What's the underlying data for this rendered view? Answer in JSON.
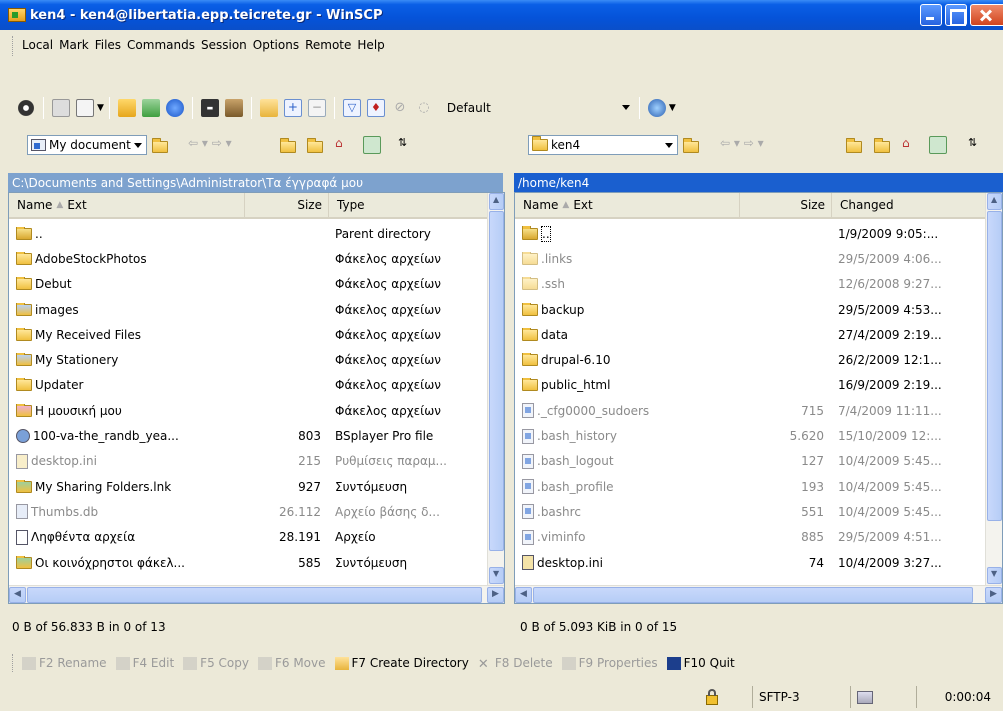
{
  "window": {
    "title": "ken4 - ken4@libertatia.epp.teicrete.gr - WinSCP"
  },
  "menu": [
    "Local",
    "Mark",
    "Files",
    "Commands",
    "Session",
    "Options",
    "Remote",
    "Help"
  ],
  "toolbar": {
    "transfer_settings": "Default"
  },
  "left": {
    "location": "My document",
    "path": "C:\\Documents and Settings\\Administrator\\Τα έγγραφά μου",
    "columns": [
      "Name",
      "Ext",
      "Size",
      "Type"
    ],
    "rows": [
      {
        "name": "..",
        "size": "",
        "type": "Parent directory",
        "icon": "parent-dir-icon"
      },
      {
        "name": "AdobeStockPhotos",
        "size": "",
        "type": "Φάκελος αρχείων",
        "icon": "folder-icon"
      },
      {
        "name": "Debut",
        "size": "",
        "type": "Φάκελος αρχείων",
        "icon": "folder-icon"
      },
      {
        "name": "images",
        "size": "",
        "type": "Φάκελος αρχείων",
        "icon": "pictures-folder-icon"
      },
      {
        "name": "My Received Files",
        "size": "",
        "type": "Φάκελος αρχείων",
        "icon": "folder-icon"
      },
      {
        "name": "My Stationery",
        "size": "",
        "type": "Φάκελος αρχείων",
        "icon": "pictures-folder-icon"
      },
      {
        "name": "Updater",
        "size": "",
        "type": "Φάκελος αρχείων",
        "icon": "folder-icon"
      },
      {
        "name": "Η μουσική μου",
        "size": "",
        "type": "Φάκελος αρχείων",
        "icon": "music-folder-icon"
      },
      {
        "name": "100-va-the_randb_yea...",
        "size": "803",
        "type": "BSplayer Pro file",
        "icon": "media-file-icon"
      },
      {
        "name": "desktop.ini",
        "size": "215",
        "type": "Ρυθμίσεις παραμ...",
        "icon": "settings-file-icon",
        "dim": true
      },
      {
        "name": "My Sharing Folders.lnk",
        "size": "927",
        "type": "Συντόμευση",
        "icon": "shortcut-icon"
      },
      {
        "name": "Thumbs.db",
        "size": "26.112",
        "type": "Αρχείο βάσης δ...",
        "icon": "database-file-icon",
        "dim": true
      },
      {
        "name": "Ληφθέντα αρχεία",
        "size": "28.191",
        "type": "Αρχείο",
        "icon": "file-icon"
      },
      {
        "name": "Οι κοινόχρηστοι φάκελ...",
        "size": "585",
        "type": "Συντόμευση",
        "icon": "shared-shortcut-icon"
      }
    ],
    "status": "0 B of 56.833 B in 0 of 13"
  },
  "right": {
    "location": "ken4",
    "path": "/home/ken4",
    "columns": [
      "Name",
      "Ext",
      "Size",
      "Changed"
    ],
    "rows": [
      {
        "name": "..",
        "size": "",
        "changed": "1/9/2009 9:05:...",
        "icon": "parent-dir-icon"
      },
      {
        "name": ".links",
        "size": "",
        "changed": "29/5/2009 4:06...",
        "icon": "folder-icon",
        "dim": true
      },
      {
        "name": ".ssh",
        "size": "",
        "changed": "12/6/2008 9:27...",
        "icon": "folder-icon",
        "dim": true
      },
      {
        "name": "backup",
        "size": "",
        "changed": "29/5/2009 4:53...",
        "icon": "folder-icon"
      },
      {
        "name": "data",
        "size": "",
        "changed": "27/4/2009 2:19...",
        "icon": "folder-icon"
      },
      {
        "name": "drupal-6.10",
        "size": "",
        "changed": "26/2/2009 12:1...",
        "icon": "folder-icon"
      },
      {
        "name": "public_html",
        "size": "",
        "changed": "16/9/2009 2:19...",
        "icon": "folder-icon"
      },
      {
        "name": "._cfg0000_sudoers",
        "size": "715",
        "changed": "7/4/2009 11:11...",
        "icon": "system-file-icon",
        "dim": true
      },
      {
        "name": ".bash_history",
        "size": "5.620",
        "changed": "15/10/2009 12:...",
        "icon": "system-file-icon",
        "dim": true
      },
      {
        "name": ".bash_logout",
        "size": "127",
        "changed": "10/4/2009 5:45...",
        "icon": "system-file-icon",
        "dim": true
      },
      {
        "name": ".bash_profile",
        "size": "193",
        "changed": "10/4/2009 5:45...",
        "icon": "system-file-icon",
        "dim": true
      },
      {
        "name": ".bashrc",
        "size": "551",
        "changed": "10/4/2009 5:45...",
        "icon": "system-file-icon",
        "dim": true
      },
      {
        "name": ".viminfo",
        "size": "885",
        "changed": "29/5/2009 4:51...",
        "icon": "system-file-icon",
        "dim": true
      },
      {
        "name": "desktop.ini",
        "size": "74",
        "changed": "10/4/2009 3:27...",
        "icon": "settings-file-icon"
      }
    ],
    "status": "0 B of 5.093 KiB in 0 of 15"
  },
  "fkeys": [
    {
      "label": "F2 Rename",
      "icon": "rename-icon",
      "enabled": false
    },
    {
      "label": "F4 Edit",
      "icon": "edit-icon",
      "enabled": false
    },
    {
      "label": "F5 Copy",
      "icon": "copy-icon",
      "enabled": false
    },
    {
      "label": "F6 Move",
      "icon": "move-icon",
      "enabled": false
    },
    {
      "label": "F7 Create Directory",
      "icon": "create-directory-icon",
      "enabled": true
    },
    {
      "label": "F8 Delete",
      "icon": "delete-icon",
      "enabled": false
    },
    {
      "label": "F9 Properties",
      "icon": "properties-icon",
      "enabled": false
    },
    {
      "label": "F10 Quit",
      "icon": "quit-icon",
      "enabled": true
    }
  ],
  "statusbar": {
    "protocol": "SFTP-3",
    "elapsed": "0:00:04"
  }
}
